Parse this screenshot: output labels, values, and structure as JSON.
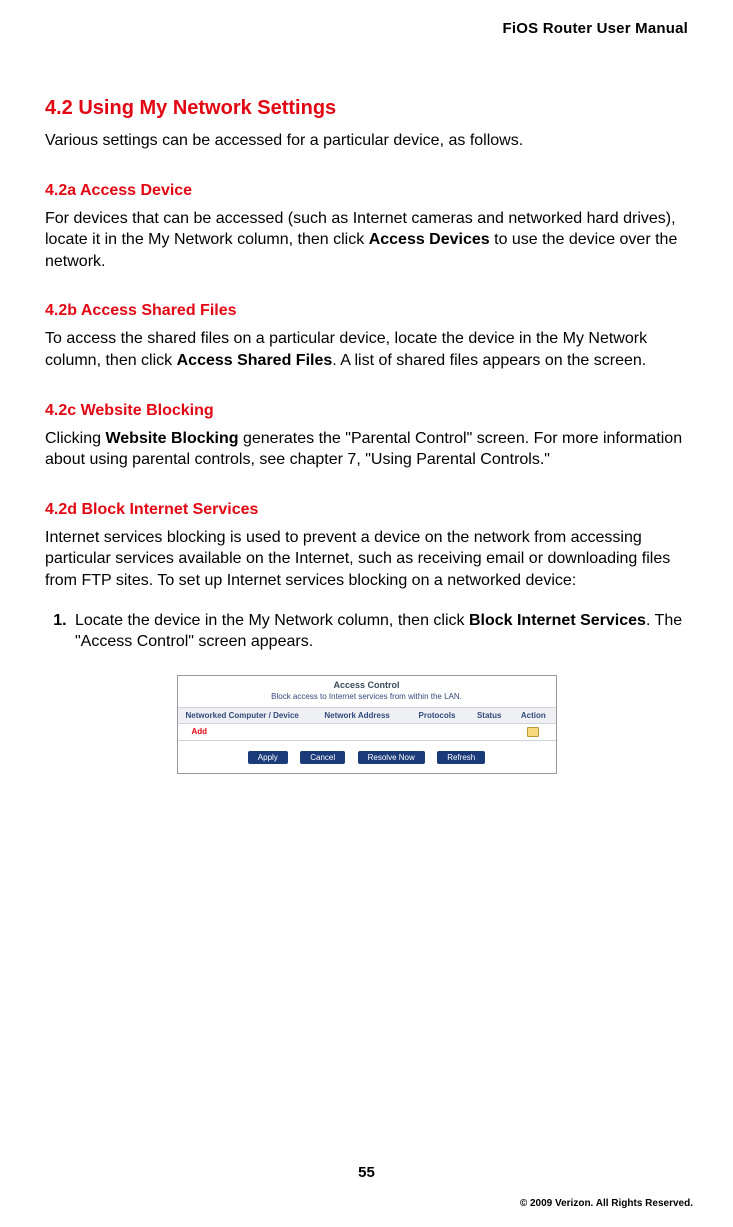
{
  "header": {
    "title": "FiOS Router User Manual"
  },
  "section": {
    "title": "4.2  Using My Network Settings",
    "intro": "Various settings can be accessed for a particular device, as follows."
  },
  "s42a": {
    "title": "4.2a  Access Device",
    "p1a": "For devices that can be accessed (such as Internet cameras and networked hard drives), locate it in the My Network column, then click ",
    "bold": "Access Devices",
    "p1b": " to use the device over the network."
  },
  "s42b": {
    "title": "4.2b  Access Shared Files",
    "p1a": "To access the shared files on a particular device, locate the device in the My Network column, then click ",
    "bold": "Access Shared Files",
    "p1b": ". A list of shared files appears on the screen."
  },
  "s42c": {
    "title": "4.2c  Website Blocking",
    "p1a": "Clicking ",
    "bold": "Website Blocking",
    "p1b": " generates the \"Parental Control\" screen. For more information about using parental controls, see chapter 7, \"Using Parental Controls.\""
  },
  "s42d": {
    "title": "4.2d  Block Internet Services",
    "intro": "Internet services blocking is used to prevent a device on the network from accessing particular services available on the Internet, such as receiving email or downloading files from FTP sites. To set up Internet services blocking on a networked device:",
    "step1a": "Locate the device in the My Network column, then click ",
    "step1bold": "Block Internet Services",
    "step1b": ". The \"Access Control\" screen appears."
  },
  "figure": {
    "title": "Access Control",
    "subtitle": "Block access to Internet services from within the LAN.",
    "cols": {
      "c1": "Networked Computer / Device",
      "c2": "Network Address",
      "c3": "Protocols",
      "c4": "Status",
      "c5": "Action"
    },
    "add": "Add",
    "buttons": {
      "apply": "Apply",
      "cancel": "Cancel",
      "resolve": "Resolve Now",
      "refresh": "Refresh"
    }
  },
  "footer": {
    "page": "55",
    "copyright": "© 2009 Verizon. All Rights Reserved."
  }
}
